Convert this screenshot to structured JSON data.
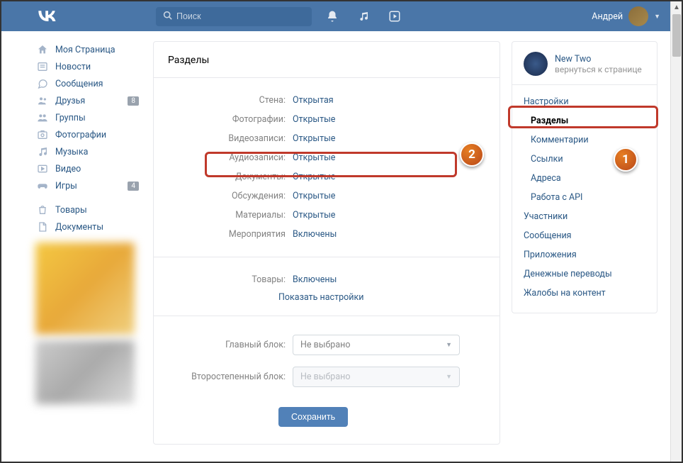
{
  "header": {
    "search_placeholder": "Поиск",
    "username": "Андрей"
  },
  "leftnav": {
    "items": [
      {
        "icon": "home",
        "label": "Моя Страница",
        "badge": null
      },
      {
        "icon": "news",
        "label": "Новости",
        "badge": null
      },
      {
        "icon": "msg",
        "label": "Сообщения",
        "badge": null
      },
      {
        "icon": "friends",
        "label": "Друзья",
        "badge": "8"
      },
      {
        "icon": "groups",
        "label": "Группы",
        "badge": null
      },
      {
        "icon": "photos",
        "label": "Фотографии",
        "badge": null
      },
      {
        "icon": "music",
        "label": "Музыка",
        "badge": null
      },
      {
        "icon": "video",
        "label": "Видео",
        "badge": null
      },
      {
        "icon": "games",
        "label": "Игры",
        "badge": "4"
      }
    ],
    "items2": [
      {
        "icon": "bag",
        "label": "Товары"
      },
      {
        "icon": "doc",
        "label": "Документы"
      }
    ]
  },
  "main": {
    "title": "Разделы",
    "rows": [
      {
        "label": "Стена:",
        "value": "Открытая"
      },
      {
        "label": "Фотографии:",
        "value": "Открытые"
      },
      {
        "label": "Видеозаписи:",
        "value": "Открытые"
      },
      {
        "label": "Аудиозаписи:",
        "value": "Открытые"
      },
      {
        "label": "Документы:",
        "value": "Открытые"
      },
      {
        "label": "Обсуждения:",
        "value": "Открытые"
      },
      {
        "label": "Материалы:",
        "value": "Открытые"
      },
      {
        "label": "Мероприятия",
        "value": "Включены"
      }
    ],
    "products_label": "Товары:",
    "products_value": "Включены",
    "show_settings": "Показать настройки",
    "main_block_label": "Главный блок:",
    "main_block_value": "Не выбрано",
    "secondary_block_label": "Второстепенный блок:",
    "secondary_block_value": "Не выбрано",
    "save": "Сохранить"
  },
  "right": {
    "community_name": "New Two",
    "community_back": "вернуться к странице",
    "items": [
      {
        "label": "Настройки",
        "sub": false,
        "active": false
      },
      {
        "label": "Разделы",
        "sub": true,
        "active": true
      },
      {
        "label": "Комментарии",
        "sub": true,
        "active": false
      },
      {
        "label": "Ссылки",
        "sub": true,
        "active": false
      },
      {
        "label": "Адреса",
        "sub": true,
        "active": false
      },
      {
        "label": "Работа с API",
        "sub": true,
        "active": false
      },
      {
        "label": "Участники",
        "sub": false,
        "active": false
      },
      {
        "label": "Сообщения",
        "sub": false,
        "active": false
      },
      {
        "label": "Приложения",
        "sub": false,
        "active": false
      },
      {
        "label": "Денежные переводы",
        "sub": false,
        "active": false
      },
      {
        "label": "Жалобы на контент",
        "sub": false,
        "active": false
      }
    ]
  },
  "callouts": {
    "c1": "1",
    "c2": "2"
  }
}
